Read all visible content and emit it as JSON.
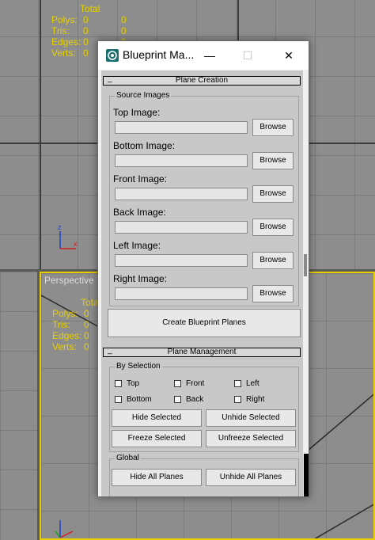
{
  "viewport_top": {
    "stats": {
      "header": "Total",
      "rows": [
        {
          "label": "Polys:",
          "v1": "0",
          "v2": "0"
        },
        {
          "label": "Tris:",
          "v1": "0",
          "v2": "0"
        },
        {
          "label": "Edges:",
          "v1": "0",
          "v2": "0"
        },
        {
          "label": "Verts:",
          "v1": "0",
          "v2": "0"
        }
      ]
    },
    "axis": {
      "z": "z",
      "x": "x"
    }
  },
  "viewport_perspective": {
    "label": "Perspective",
    "stats": {
      "header": "Total",
      "rows": [
        {
          "label": "Polys:",
          "v1": "0"
        },
        {
          "label": "Tris:",
          "v1": "0"
        },
        {
          "label": "Edges:",
          "v1": "0"
        },
        {
          "label": "Verts:",
          "v1": "0"
        }
      ]
    }
  },
  "dialog": {
    "title": "Blueprint Ma...",
    "minimize": "—",
    "maximize": "☐",
    "close": "✕",
    "plane_creation": {
      "sign": "_",
      "header": "Plane Creation",
      "source_images_title": "Source Images",
      "images": [
        {
          "label": "Top Image:",
          "value": "",
          "browse": "Browse"
        },
        {
          "label": "Bottom Image:",
          "value": "",
          "browse": "Browse"
        },
        {
          "label": "Front Image:",
          "value": "",
          "browse": "Browse"
        },
        {
          "label": "Back Image:",
          "value": "",
          "browse": "Browse"
        },
        {
          "label": "Left Image:",
          "value": "",
          "browse": "Browse"
        },
        {
          "label": "Right Image:",
          "value": "",
          "browse": "Browse"
        }
      ],
      "create_button": "Create Blueprint Planes"
    },
    "plane_management": {
      "sign": "_",
      "header": "Plane Management",
      "by_selection_title": "By Selection",
      "checkboxes": [
        {
          "label": "Top",
          "checked": false
        },
        {
          "label": "Front",
          "checked": false
        },
        {
          "label": "Left",
          "checked": false
        },
        {
          "label": "Bottom",
          "checked": false
        },
        {
          "label": "Back",
          "checked": false
        },
        {
          "label": "Right",
          "checked": false
        }
      ],
      "hide_selected": "Hide Selected",
      "unhide_selected": "Unhide Selected",
      "freeze_selected": "Freeze Selected",
      "unfreeze_selected": "Unfreeze Selected",
      "global_title": "Global",
      "hide_all": "Hide All Planes",
      "unhide_all": "Unhide All Planes"
    }
  },
  "colors": {
    "stats_yellow": "#e8d000",
    "active_viewport_border": "#e8d000",
    "axis_x": "#d02020",
    "axis_y": "#20a020",
    "axis_z": "#2040d0"
  }
}
